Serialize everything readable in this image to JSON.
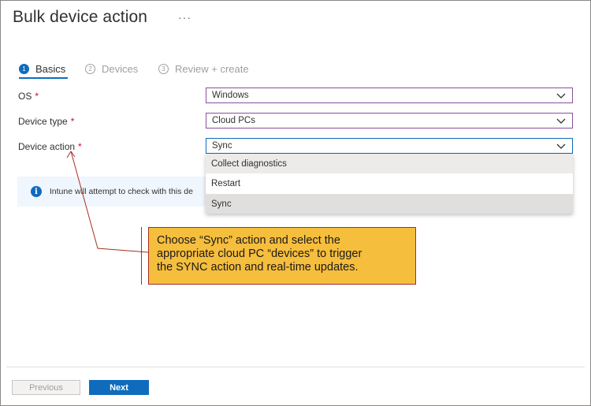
{
  "header": {
    "title": "Bulk device action",
    "more": "···"
  },
  "wizard": {
    "steps": [
      {
        "num": "1",
        "label": "Basics"
      },
      {
        "num": "2",
        "label": "Devices"
      },
      {
        "num": "3",
        "label": "Review + create"
      }
    ]
  },
  "form": {
    "os": {
      "label": "OS",
      "value": "Windows"
    },
    "device_type": {
      "label": "Device type",
      "value": "Cloud PCs"
    },
    "device_action": {
      "label": "Device action",
      "value": "Sync"
    },
    "required_mark": "*"
  },
  "dropdown": {
    "options": [
      "Collect diagnostics",
      "Restart",
      "Sync"
    ],
    "selected": "Sync"
  },
  "info": {
    "text": "Intune will attempt to check with this de"
  },
  "callout": {
    "line1": "Choose “Sync” action and select the",
    "line2": "appropriate cloud PC “devices” to trigger",
    "line3": "the SYNC action and real-time updates."
  },
  "footer": {
    "previous_label": "Previous",
    "next_label": "Next"
  },
  "colors": {
    "accent": "#0f6cbd",
    "callout_bg": "#f6be3d",
    "callout_border": "#a5301f",
    "required": "#c50f1f"
  }
}
